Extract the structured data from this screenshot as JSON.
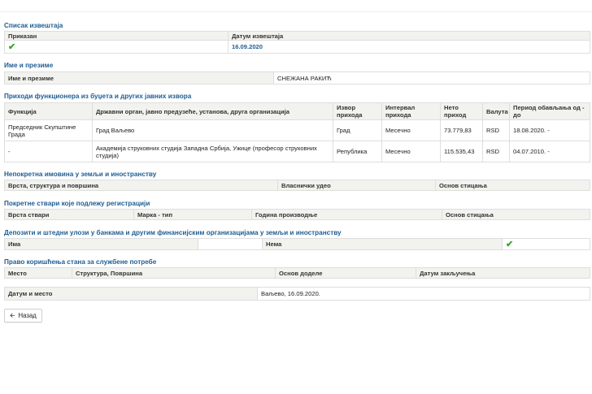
{
  "report_list": {
    "title": "Списак извештаја",
    "col_shown": "Приказан",
    "col_report_date": "Датум извештаја",
    "shown_icon": "check-icon",
    "report_date": "16.09.2020"
  },
  "name_section": {
    "title": "Име и презиме",
    "label": "Име и презиме",
    "value": "СНЕЖАНА РАКИЋ"
  },
  "income": {
    "title": "Приходи функционера из буџета и других јавних извора",
    "headers": [
      "Функција",
      "Државни орган, јавно предузеће, установа, друга организација",
      "Извор прихода",
      "Интервал прихода",
      "Нето приход",
      "Валута",
      "Период обављања од - до"
    ],
    "rows": [
      [
        "Председник Скупштине Града",
        "Град Ваљево",
        "Град",
        "Месечно",
        "73.779,83",
        "RSD",
        "18.08.2020. -"
      ],
      [
        "-",
        "Академија струковних студија Западна Србија, Ужице (професор струковних студија)",
        "Република",
        "Месечно",
        "115.535,43",
        "RSD",
        "04.07.2010. -"
      ]
    ]
  },
  "real_estate": {
    "title": "Непокретна имовина у земљи и иностранству",
    "headers": [
      "Врста, структура и површина",
      "Власнички удео",
      "Основ стицања"
    ]
  },
  "movables": {
    "title": "Покретне ствари које подлежу регистрацији",
    "headers": [
      "Врста ствари",
      "Марка - тип",
      "Година производње",
      "Основ стицања"
    ]
  },
  "deposits": {
    "title": "Депозити и штедни улози у банкама и другим финансијским организацијама у земљи и иностранству",
    "has_label": "Има",
    "none_label": "Нема",
    "none_icon": "check-icon"
  },
  "housing": {
    "title": "Право коришћења стана за службене потребе",
    "headers": [
      "Место",
      "Структура, Површина",
      "Основ доделе",
      "Датум закључења"
    ]
  },
  "date_place": {
    "label": "Датум и место",
    "value": "Ваљево, 16.09.2020."
  },
  "back_button": {
    "icon": "arrow-left-icon",
    "label": "Назад"
  },
  "colors": {
    "section_title": "#1f5d94",
    "header_bg": "#f2f2ee",
    "check": "#3aa52a"
  }
}
